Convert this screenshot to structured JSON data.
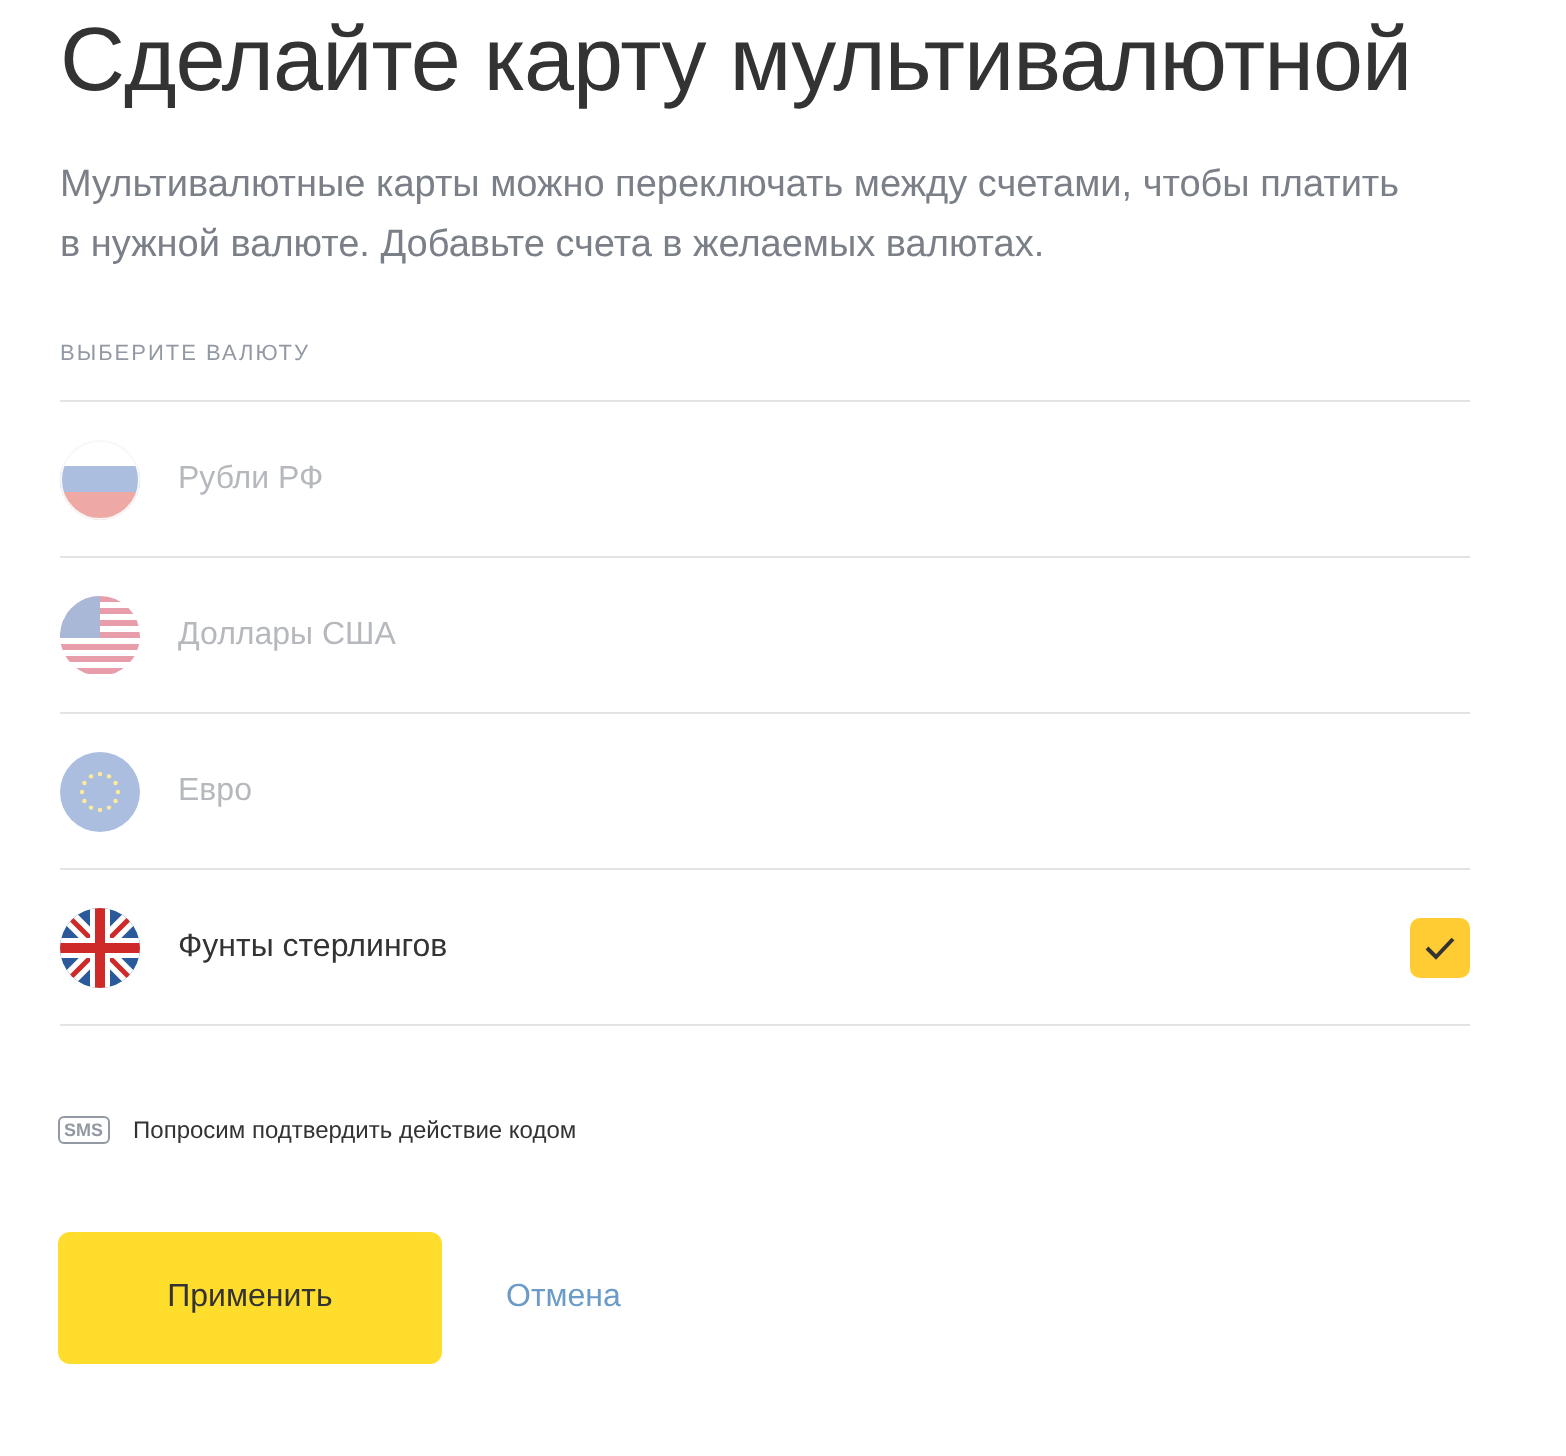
{
  "title": "Сделайте карту мультивалютной",
  "description": "Мультивалютные карты можно переключать между счетами, чтобы платить в нужной валюте. Добавьте счета в желаемых валютах.",
  "section_label": "ВЫБЕРИТЕ ВАЛЮТУ",
  "currencies": [
    {
      "kind": "ru",
      "label": "Рубли РФ",
      "disabled": true,
      "checked": false
    },
    {
      "kind": "us",
      "label": "Доллары США",
      "disabled": true,
      "checked": false
    },
    {
      "kind": "eu",
      "label": "Евро",
      "disabled": true,
      "checked": false
    },
    {
      "kind": "gb",
      "label": "Фунты стерлингов",
      "disabled": false,
      "checked": true
    }
  ],
  "notice": {
    "icon_text": "SMS",
    "text": "Попросим подтвердить действие кодом"
  },
  "buttons": {
    "apply": "Применить",
    "cancel": "Отмена"
  }
}
